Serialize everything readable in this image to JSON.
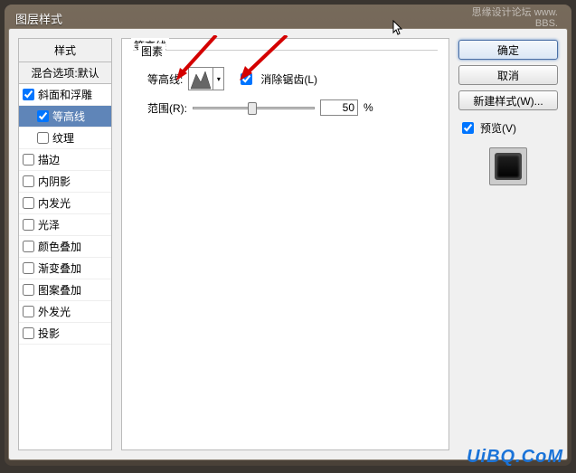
{
  "window": {
    "title": "图层样式"
  },
  "watermark": {
    "top_line1": "思缘设计论坛  www.",
    "top_line2": "BBS.",
    "bottom": "UiBQ.CoM"
  },
  "styles_panel": {
    "header": "样式",
    "blend_options": "混合选项:默认",
    "items": [
      {
        "label": "斜面和浮雕",
        "checked": true,
        "selected": false,
        "indent": 0
      },
      {
        "label": "等高线",
        "checked": true,
        "selected": true,
        "indent": 1
      },
      {
        "label": "纹理",
        "checked": false,
        "selected": false,
        "indent": 1
      },
      {
        "label": "描边",
        "checked": false,
        "selected": false,
        "indent": 0
      },
      {
        "label": "内阴影",
        "checked": false,
        "selected": false,
        "indent": 0
      },
      {
        "label": "内发光",
        "checked": false,
        "selected": false,
        "indent": 0
      },
      {
        "label": "光泽",
        "checked": false,
        "selected": false,
        "indent": 0
      },
      {
        "label": "颜色叠加",
        "checked": false,
        "selected": false,
        "indent": 0
      },
      {
        "label": "渐变叠加",
        "checked": false,
        "selected": false,
        "indent": 0
      },
      {
        "label": "图案叠加",
        "checked": false,
        "selected": false,
        "indent": 0
      },
      {
        "label": "外发光",
        "checked": false,
        "selected": false,
        "indent": 0
      },
      {
        "label": "投影",
        "checked": false,
        "selected": false,
        "indent": 0
      }
    ]
  },
  "center": {
    "group_title": "等高线",
    "sub_group_title": "图素",
    "contour_label": "等高线:",
    "antialias_checked": true,
    "antialias_label": "消除锯齿(L)",
    "range_label": "范围(R):",
    "range_value": "50",
    "range_unit": "%"
  },
  "right": {
    "ok": "确定",
    "cancel": "取消",
    "new_style": "新建样式(W)...",
    "preview_checked": true,
    "preview_label": "预览(V)"
  }
}
